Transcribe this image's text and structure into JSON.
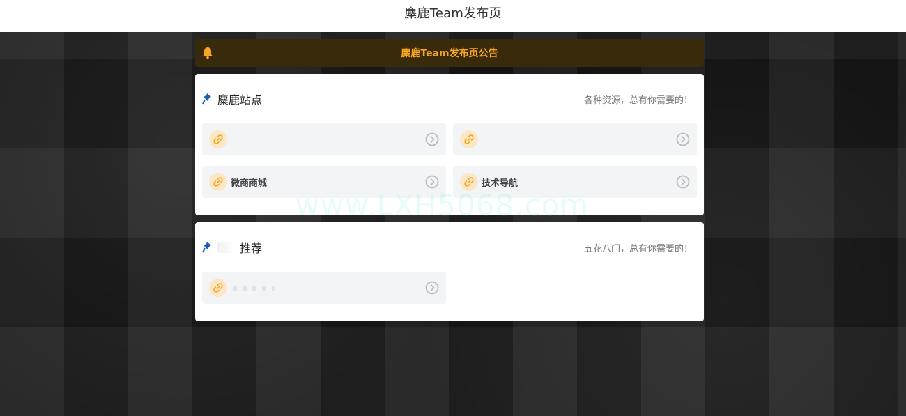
{
  "header": {
    "title": "麋鹿Team发布页"
  },
  "notice": {
    "icon": "bell-icon",
    "text": "麋鹿Team发布页公告"
  },
  "sections": [
    {
      "title": "麋鹿站点",
      "subtitle": "各种资源，总有你需要的！",
      "links": [
        {
          "label": ""
        },
        {
          "label": ""
        },
        {
          "label": "微商商城"
        },
        {
          "label": "技术导航"
        }
      ]
    },
    {
      "title": "推荐",
      "subtitle": "五花八门，总有你需要的！",
      "links": [
        {
          "label": ""
        }
      ]
    }
  ],
  "watermark": "www.LXH5068.com",
  "colors": {
    "accent": "#f5a623",
    "notice_bg": "#3a2a0c",
    "card_bg": "#ffffff",
    "link_bg": "#f3f4f6",
    "link_icon_bg": "#fbe7c5",
    "pin_blue": "#1e5fb3"
  }
}
